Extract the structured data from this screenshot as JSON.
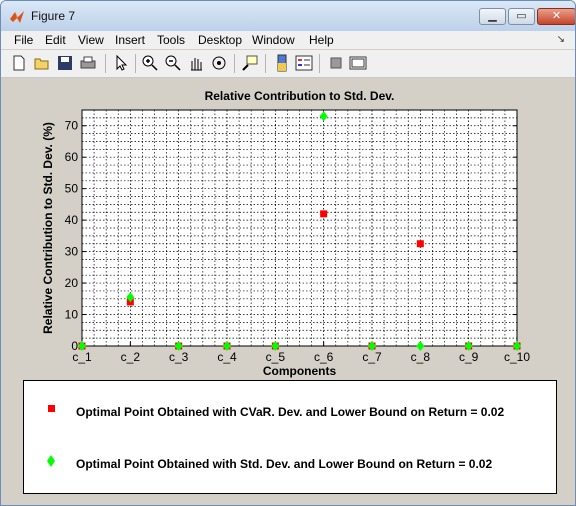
{
  "window": {
    "title": "Figure 7"
  },
  "menu": [
    "File",
    "Edit",
    "View",
    "Insert",
    "Tools",
    "Desktop",
    "Window",
    "Help"
  ],
  "toolbar": {
    "icons": [
      "new-figure-icon",
      "open-file-icon",
      "save-icon",
      "print-icon",
      "select-arrow-icon",
      "zoom-in-icon",
      "zoom-out-icon",
      "pan-hand-icon",
      "rotate-3d-icon",
      "data-cursor-icon",
      "colorbar-icon",
      "legend-icon",
      "hide-plot-tools-icon",
      "show-plot-tools-icon"
    ]
  },
  "chart_data": {
    "type": "scatter",
    "title": "Relative Contribution to Std. Dev.",
    "xlabel": "Components",
    "ylabel": "Relative Contribution to Std. Dev. (%)",
    "categories": [
      "c_1",
      "c_2",
      "c_3",
      "c_4",
      "c_5",
      "c_6",
      "c_7",
      "c_8",
      "c_9",
      "c_10"
    ],
    "ylim": [
      0,
      75
    ],
    "yticks": [
      0,
      10,
      20,
      30,
      40,
      50,
      60,
      70
    ],
    "grid": true,
    "legend_position": "bottom",
    "series": [
      {
        "name": "Optimal Point Obtained with CVaR. Dev. and Lower Bound on Return = 0.02",
        "marker": "square",
        "color": "#ff0000",
        "values": [
          0,
          14,
          0,
          0,
          0,
          42,
          0,
          32.5,
          0,
          0
        ]
      },
      {
        "name": "Optimal Point Obtained with Std. Dev. and Lower Bound on Return = 0.02",
        "marker": "diamond",
        "color": "#00ff00",
        "values": [
          0,
          15.5,
          0,
          0,
          0,
          73,
          0,
          0,
          0,
          0
        ]
      }
    ]
  }
}
